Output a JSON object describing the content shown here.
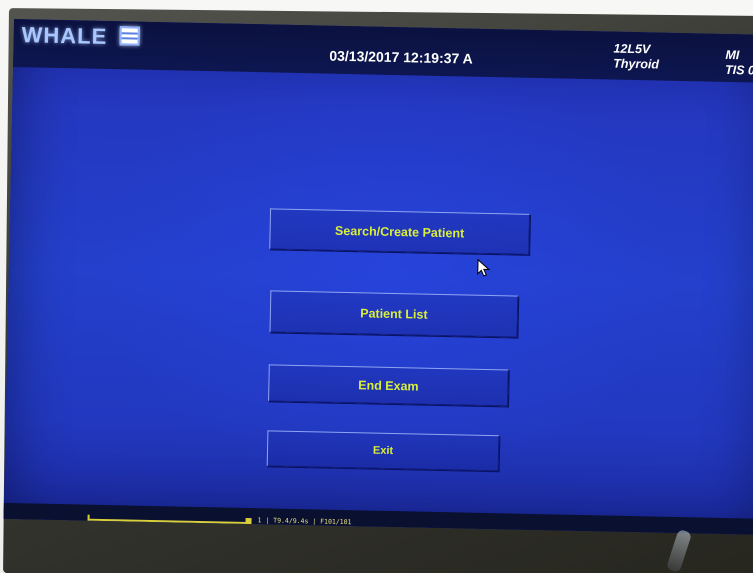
{
  "brand": {
    "logo_text": "WHALE"
  },
  "header": {
    "datetime": "03/13/2017  12:19:37 A",
    "probe_name": "12L5V",
    "preset_name": "Thyroid",
    "mi_label": "MI",
    "tis_label": "TIS 0"
  },
  "menu": {
    "search_create_patient": "Search/Create Patient",
    "patient_list": "Patient List",
    "end_exam": "End Exam",
    "exit": "Exit"
  },
  "cine": {
    "status_text": "1 | T9.4/9.4s | F101/101"
  },
  "colors": {
    "screen_background": "#2438c0",
    "button_text": "#d9ef3a",
    "header_background": "#0d1650"
  },
  "icons": {
    "cursor": "mouse-pointer-icon",
    "logo_mark": "logo-box-icon"
  }
}
